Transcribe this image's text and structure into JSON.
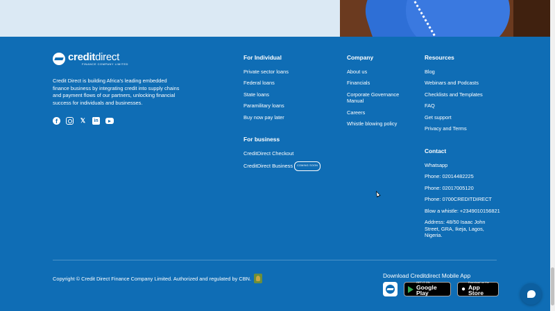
{
  "colors": {
    "footer_bg": "#0f6db5",
    "hero_bg": "#dbe9f4",
    "text": "#ffffff"
  },
  "brand": {
    "logo_word_bold": "credit",
    "logo_word_light": "direct",
    "logo_sub": "FINANCE COMPANY LIMITED",
    "description": "Credit Direct is building Africa’s leading embedded finance business by integrating credit into supply chains and payment flows of our partners, unlocking financial success for individuals and businesses."
  },
  "socials": [
    {
      "icon": "facebook-icon",
      "glyph": "f"
    },
    {
      "icon": "instagram-icon",
      "glyph": ""
    },
    {
      "icon": "x-icon",
      "glyph": "𝕏"
    },
    {
      "icon": "linkedin-icon",
      "glyph": "in"
    },
    {
      "icon": "youtube-icon",
      "glyph": ""
    }
  ],
  "individual": {
    "title": "For Individual",
    "links": [
      "Private sector loans",
      "Federal loans",
      "State loans",
      "Paramilitary loans",
      "Buy now pay later"
    ]
  },
  "business": {
    "title": "For business",
    "links": [
      "CreditDirect Checkout",
      "CreditDirect Business"
    ],
    "badge": "COMING SOON"
  },
  "company": {
    "title": "Company",
    "links": [
      "About us",
      "Financials",
      "Corporate Governance Manual",
      "Careers",
      "Whistle blowing policy"
    ]
  },
  "resources": {
    "title": "Resources",
    "links": [
      "Blog",
      "Webinars and Podcasts",
      "Checklists and Templates",
      "FAQ",
      "Get support",
      "Privacy and Terms"
    ]
  },
  "contact": {
    "title": "Contact",
    "items": [
      "Whatsapp",
      "Phone: 02014482225",
      "Phone: 02017005120",
      "Phone: 0700CREDITDIRECT",
      "Blow a whistle: +2349010156821",
      "Address: 48/50 Isaac John Street, GRA, Ikeja, Lagos, Nigeria."
    ]
  },
  "bottom": {
    "copyright": "Copyright © Credit Direct Finance Company Limited. Authorized and regulated by CBN.",
    "app_title": "Download Creditdirect Mobile App",
    "google_small": "GET IT ON",
    "google_big": "Google Play",
    "apple_small": "Download on the",
    "apple_big": "App Store"
  }
}
